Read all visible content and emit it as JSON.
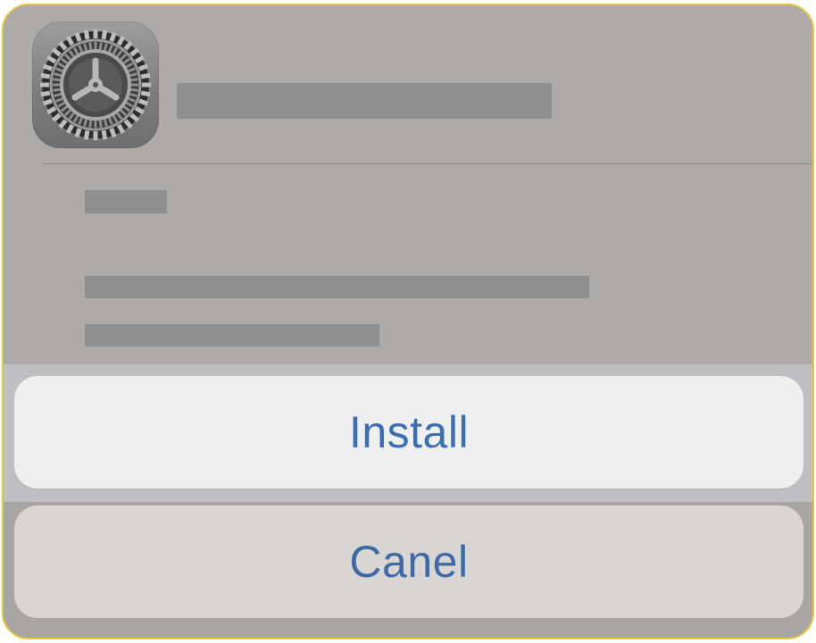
{
  "dialog": {
    "icon": "settings-gear-icon",
    "colors": {
      "frame_border": "#e6c43c",
      "button_text": "#3a6fb4",
      "install_bg": "#efefef",
      "cancel_bg": "#d8d5d3"
    }
  },
  "actions": {
    "install_label": "Install",
    "cancel_label": "Canel"
  }
}
